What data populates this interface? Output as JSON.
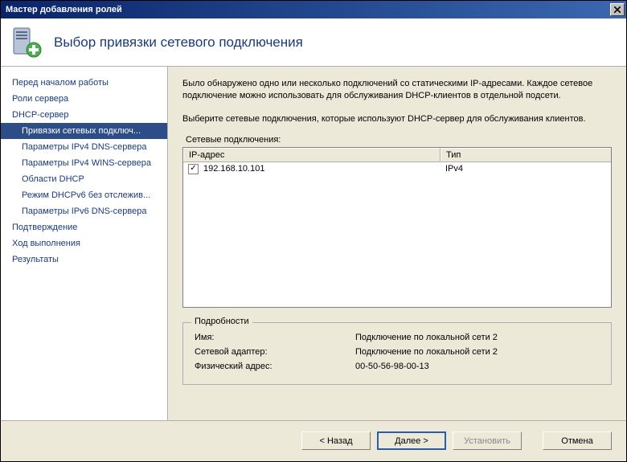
{
  "window": {
    "title": "Мастер добавления ролей"
  },
  "header": {
    "title": "Выбор привязки сетевого подключения"
  },
  "sidebar": {
    "items": [
      {
        "label": "Перед началом работы",
        "sub": false,
        "selected": false
      },
      {
        "label": "Роли сервера",
        "sub": false,
        "selected": false
      },
      {
        "label": "DHCP-сервер",
        "sub": false,
        "selected": false
      },
      {
        "label": "Привязки сетевых подключ...",
        "sub": true,
        "selected": true
      },
      {
        "label": "Параметры IPv4 DNS-сервера",
        "sub": true,
        "selected": false
      },
      {
        "label": "Параметры IPv4 WINS-сервера",
        "sub": true,
        "selected": false
      },
      {
        "label": "Области DHCP",
        "sub": true,
        "selected": false
      },
      {
        "label": "Режим DHCPv6 без отслежив...",
        "sub": true,
        "selected": false
      },
      {
        "label": "Параметры IPv6 DNS-сервера",
        "sub": true,
        "selected": false
      },
      {
        "label": "Подтверждение",
        "sub": false,
        "selected": false
      },
      {
        "label": "Ход выполнения",
        "sub": false,
        "selected": false
      },
      {
        "label": "Результаты",
        "sub": false,
        "selected": false
      }
    ]
  },
  "main": {
    "intro": "Было обнаружено одно или несколько подключений со статическими IP-адресами. Каждое сетевое подключение можно использовать для обслуживания DHCP-клиентов в отдельной подсети.",
    "instruction": "Выберите сетевые подключения, которые используют DHCP-сервер для обслуживания клиентов.",
    "table_label": "Сетевые подключения:",
    "columns": {
      "ip": "IP-адрес",
      "type": "Тип"
    },
    "rows": [
      {
        "checked": true,
        "ip": "192.168.10.101",
        "type": "IPv4"
      }
    ],
    "details": {
      "legend": "Подробности",
      "name_label": "Имя:",
      "name_value": "Подключение по локальной сети 2",
      "adapter_label": "Сетевой адаптер:",
      "adapter_value": "Подключение по локальной сети 2",
      "mac_label": "Физический адрес:",
      "mac_value": "00-50-56-98-00-13"
    }
  },
  "buttons": {
    "back": "< Назад",
    "next": "Далее >",
    "install": "Установить",
    "cancel": "Отмена"
  }
}
